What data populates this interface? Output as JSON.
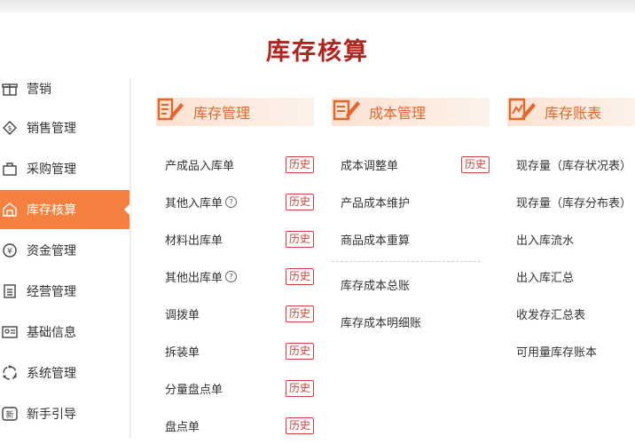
{
  "page_title": "库存核算",
  "sidebar": {
    "items": [
      {
        "label": "营销",
        "icon": "gift-icon",
        "active": false
      },
      {
        "label": "销售管理",
        "icon": "money-tag-icon",
        "active": false
      },
      {
        "label": "采购管理",
        "icon": "shopping-bag-icon",
        "active": false
      },
      {
        "label": "库存核算",
        "icon": "warehouse-icon",
        "active": true
      },
      {
        "label": "资金管理",
        "icon": "yen-coin-icon",
        "active": false
      },
      {
        "label": "经营管理",
        "icon": "clipboard-icon",
        "active": false
      },
      {
        "label": "基础信息",
        "icon": "id-card-icon",
        "active": false
      },
      {
        "label": "系统管理",
        "icon": "circle-cycle-icon",
        "active": false
      },
      {
        "label": "新手引导",
        "icon": "new-badge-icon",
        "active": false
      }
    ]
  },
  "columns": [
    {
      "title": "库存管理",
      "items": [
        {
          "label": "产成品入库单",
          "history": "历史"
        },
        {
          "label": "其他入库单",
          "help": "?",
          "history": "历史"
        },
        {
          "label": "材料出库单",
          "history": "历史"
        },
        {
          "label": "其他出库单",
          "help": "?",
          "history": "历史"
        },
        {
          "label": "调拨单",
          "history": "历史"
        },
        {
          "label": "拆装单",
          "history": "历史"
        },
        {
          "label": "分量盘点单",
          "history": "历史"
        },
        {
          "label": "盘点单",
          "history": "历史"
        }
      ]
    },
    {
      "title": "成本管理",
      "items": [
        {
          "label": "成本调整单",
          "history": "历史"
        },
        {
          "label": "产品成本维护"
        },
        {
          "label": "商品成本重算"
        }
      ],
      "items_after_divider": [
        {
          "label": "库存成本总账"
        },
        {
          "label": "库存成本明细账"
        }
      ]
    },
    {
      "title": "库存账表",
      "items": [
        {
          "label": "现存量（库存状况表）"
        },
        {
          "label": "现存量（库存分布表）"
        },
        {
          "label": "出入库流水"
        },
        {
          "label": "出入库汇总"
        },
        {
          "label": "收发存汇总表"
        },
        {
          "label": "可用量库存账本"
        }
      ]
    }
  ],
  "colors": {
    "accent": "#f4813f",
    "title": "#b2241e",
    "history": "#d8403a"
  }
}
